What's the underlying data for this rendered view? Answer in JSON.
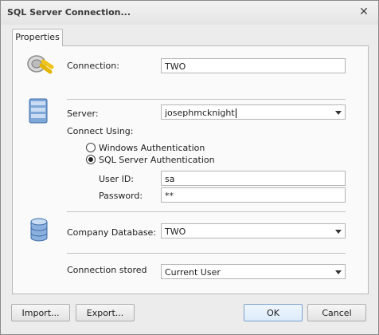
{
  "window": {
    "title": "SQL Server Connection...",
    "close_symbol": "✕"
  },
  "tabs": [
    {
      "label": "Properties"
    }
  ],
  "connection": {
    "label": "Connection:",
    "value": "TWO",
    "icon": "plug-icon"
  },
  "server": {
    "label": "Server:",
    "value": "josephmcknight",
    "icon": "server-icon",
    "connect_using_label": "Connect Using:",
    "auth_options": [
      {
        "label": "Windows Authentication",
        "selected": false
      },
      {
        "label": "SQL Server Authentication",
        "selected": true
      }
    ],
    "user_id_label": "User ID:",
    "user_id_value": "sa",
    "password_label": "Password:",
    "password_value": "**"
  },
  "database": {
    "label": "Company Database:",
    "value": "TWO",
    "icon": "database-icon"
  },
  "storage": {
    "label": "Connection stored",
    "value": "Current User"
  },
  "buttons": {
    "import": "Import...",
    "export": "Export...",
    "ok": "OK",
    "cancel": "Cancel"
  }
}
